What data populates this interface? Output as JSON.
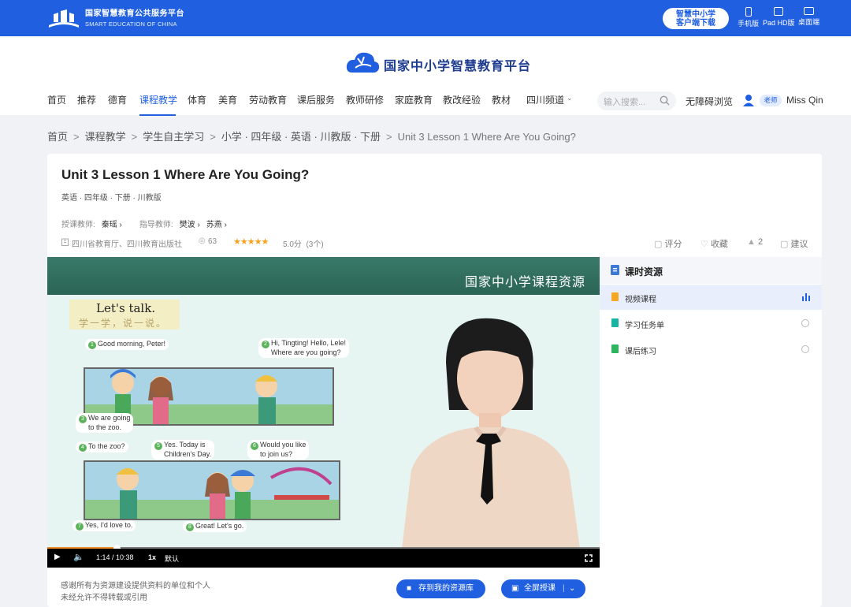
{
  "topbar": {
    "logo_cn": "国家智慧教育公共服务平台",
    "logo_en": "SMART EDUCATION OF CHINA",
    "download_line1": "智慧中小学",
    "download_line2": "客户端下载",
    "devices": [
      "手机版",
      "Pad HD版",
      "桌面端"
    ],
    "bg_color": "#1f5fe0"
  },
  "header": {
    "brand": "国家中小学智慧教育平台",
    "nav": [
      "首页",
      "推荐",
      "德育",
      "课程教学",
      "体育",
      "美育",
      "劳动教育",
      "课后服务",
      "教师研修",
      "家庭教育",
      "教改经验",
      "教材",
      "四川频道"
    ],
    "active_nav": "课程教学",
    "search_placeholder": "输入搜索...",
    "accessibility": "无障碍浏览",
    "role": "老师",
    "user_name": "Miss Qin"
  },
  "breadcrumb": [
    "首页",
    "课程教学",
    "学生自主学习",
    "小学 · 四年级 · 英语 · 川教版 · 下册",
    "Unit 3 Lesson 1 Where Are You Going?"
  ],
  "lesson": {
    "title": "Unit 3 Lesson 1 Where Are You Going?",
    "subtitle": "英语 · 四年级 · 下册 · 川教版",
    "teacher_label": "授课教师:",
    "teacher": "秦瑶",
    "advisor_label": "指导教师:",
    "advisors": [
      "樊波",
      "苏燕"
    ],
    "publisher": "四川省教育厅、四川教育出版社",
    "views": "63",
    "stars": "★★★★★",
    "score": "5.0分",
    "rating_count": "(3个)",
    "actions": {
      "rate": "评分",
      "collect": "收藏",
      "likes": "2",
      "suggest": "建议"
    }
  },
  "video": {
    "caption": "国家中小学课程资源",
    "lets_talk_en": "Let's talk.",
    "lets_talk_cn": "学一学，说一说。",
    "bubbles": [
      {
        "n": "1",
        "text": "Good morning, Peter!"
      },
      {
        "n": "2",
        "text_line1": "Hi, Tingting! Hello, Lele!",
        "text_line2": "Where are you going?"
      },
      {
        "n": "3",
        "text_line1": "We are going",
        "text_line2": "to the zoo."
      },
      {
        "n": "4",
        "text": "To the zoo?"
      },
      {
        "n": "5",
        "text_line1": "Yes. Today is",
        "text_line2": "Children's Day."
      },
      {
        "n": "6",
        "text_line1": "Would you like",
        "text_line2": "to join us?"
      },
      {
        "n": "7",
        "text": "Yes, I'd love to."
      },
      {
        "n": "8",
        "text": "Great! Let's go."
      }
    ],
    "current_time": "1:14",
    "duration": "10:38",
    "time_display": "1:14 / 10:38",
    "speed": "1x",
    "quality": "默认",
    "progress": 0.126
  },
  "side": {
    "title": "课时资源",
    "items": [
      {
        "label": "视频课程",
        "selected": true,
        "color": "#f5a623"
      },
      {
        "label": "学习任务单",
        "selected": false,
        "color": "#17b3a3"
      },
      {
        "label": "课后练习",
        "selected": false,
        "color": "#2db55d"
      }
    ]
  },
  "footer": {
    "note_line1": "感谢所有为资源建设提供资料的单位和个人",
    "note_line2": "未经允许不得转载或引用",
    "save_button": "存到我的资源库",
    "fullscreen_button": "全屏授课"
  }
}
